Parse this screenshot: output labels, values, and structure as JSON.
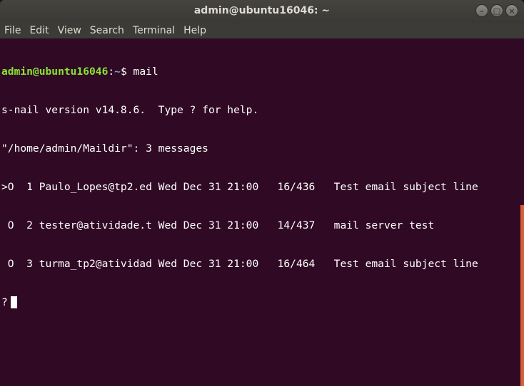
{
  "window": {
    "title": "admin@ubuntu16046: ~",
    "controls": {
      "minimize_icon": "–",
      "maximize_icon": "□",
      "close_icon": "×"
    }
  },
  "menubar": {
    "items": [
      "File",
      "Edit",
      "View",
      "Search",
      "Terminal",
      "Help"
    ]
  },
  "terminal": {
    "prompt_user": "admin@ubuntu16046",
    "prompt_sep": ":",
    "prompt_path": "~",
    "prompt_end": "$ mail",
    "lines": [
      "s-nail version v14.8.6.  Type ? for help.",
      "\"/home/admin/Maildir\": 3 messages",
      ">O  1 Paulo_Lopes@tp2.ed Wed Dec 31 21:00   16/436   Test email subject line",
      " O  2 tester@atividade.t Wed Dec 31 21:00   14/437   mail server test",
      " O  3 turma_tp2@atividad Wed Dec 31 21:00   16/464   Test email subject line"
    ],
    "input_prompt": "?"
  },
  "colors": {
    "terminal_bg": "#300a24",
    "prompt_user": "#8ae234",
    "prompt_path": "#729fcf",
    "scrollbar_accent": "#d85f3c"
  }
}
